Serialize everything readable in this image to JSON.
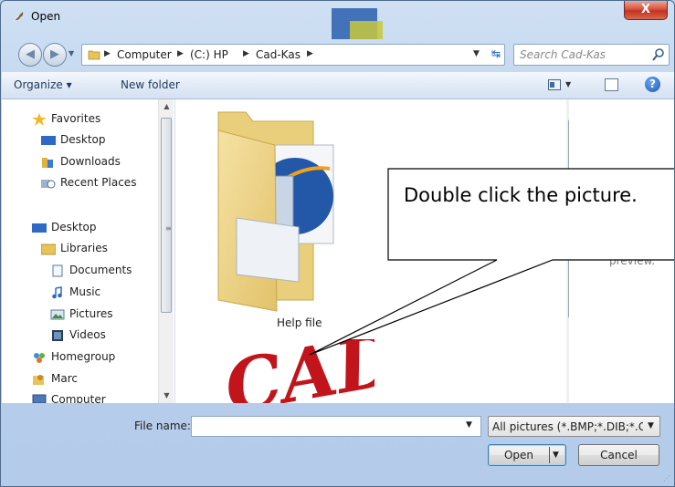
{
  "window": {
    "title": "Open",
    "close_label": "X"
  },
  "navigation": {
    "back_label": "◀",
    "forward_label": "▶",
    "address": {
      "crumbs": [
        "Computer",
        "(C:) HP",
        "Cad-Kas"
      ]
    },
    "search": {
      "placeholder": "Search Cad-Kas"
    }
  },
  "toolbar": {
    "organize_label": "Organize ▾",
    "new_folder_label": "New folder",
    "help_label": "?"
  },
  "sidebar": {
    "items": [
      {
        "label": "Favorites",
        "icon": "star-icon"
      },
      {
        "label": "Desktop",
        "icon": "desktop-icon"
      },
      {
        "label": "Downloads",
        "icon": "downloads-icon"
      },
      {
        "label": "Recent Places",
        "icon": "recent-places-icon"
      },
      {
        "label": "Desktop",
        "icon": "desktop-icon"
      },
      {
        "label": "Libraries",
        "icon": "libraries-icon"
      },
      {
        "label": "Documents",
        "icon": "documents-icon"
      },
      {
        "label": "Music",
        "icon": "music-icon"
      },
      {
        "label": "Pictures",
        "icon": "pictures-icon"
      },
      {
        "label": "Videos",
        "icon": "videos-icon"
      },
      {
        "label": "Homegroup",
        "icon": "homegroup-icon"
      },
      {
        "label": "Marc",
        "icon": "user-folder-icon"
      },
      {
        "label": "Computer",
        "icon": "computer-icon"
      }
    ]
  },
  "files": {
    "items": [
      {
        "label": "Help file",
        "icon": "folder-icon"
      },
      {
        "label": "CAD",
        "icon": "cad-image-icon"
      }
    ]
  },
  "preview": {
    "text": "preview."
  },
  "callout": {
    "text": "Double click the picture."
  },
  "footer": {
    "file_name_label": "File name:",
    "file_name_value": "",
    "filter_value": "All pictures (*.BMP;*.DIB;*.GI",
    "open_label": "Open",
    "cancel_label": "Cancel"
  }
}
